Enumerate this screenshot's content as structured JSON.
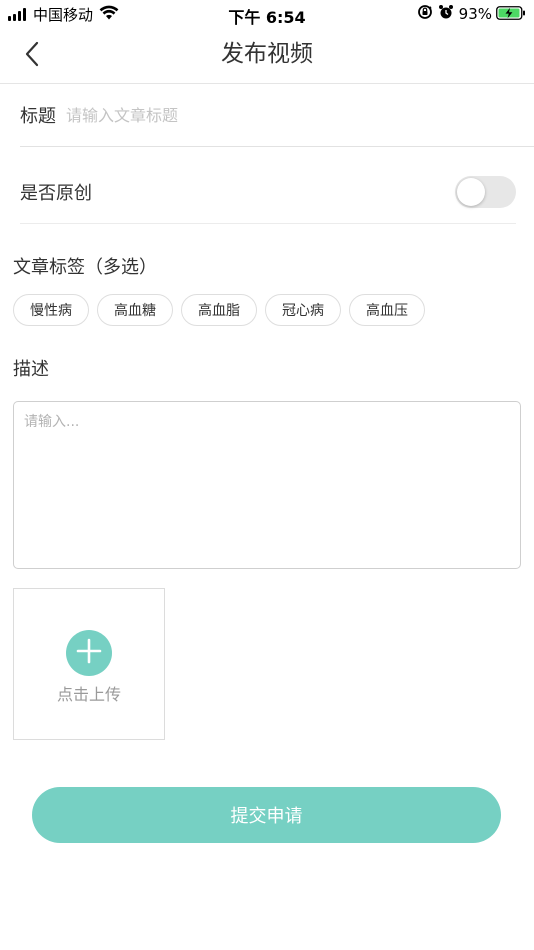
{
  "status_bar": {
    "carrier": "中国移动",
    "time": "下午 6:54",
    "battery_percent": "93%"
  },
  "nav": {
    "title": "发布视频"
  },
  "form": {
    "title_label": "标题",
    "title_placeholder": "请输入文章标题",
    "title_value": "",
    "original_label": "是否原创",
    "original_on": false,
    "tags_label": "文章标签（多选）",
    "tags": [
      "慢性病",
      "高血糖",
      "高血脂",
      "冠心病",
      "高血压"
    ],
    "desc_label": "描述",
    "desc_placeholder": "请输入...",
    "upload_label": "点击上传",
    "submit_label": "提交申请"
  },
  "colors": {
    "accent": "#76d0c3",
    "toggle_off": "#e7e7e7",
    "battery_green": "#4cd964"
  },
  "icons": {
    "back": "chevron-left-icon",
    "upload": "plus-icon",
    "wifi": "wifi-icon",
    "signal": "signal-icon",
    "orientation_lock": "orientation-lock-icon",
    "alarm": "alarm-icon",
    "battery": "battery-charging-icon"
  }
}
